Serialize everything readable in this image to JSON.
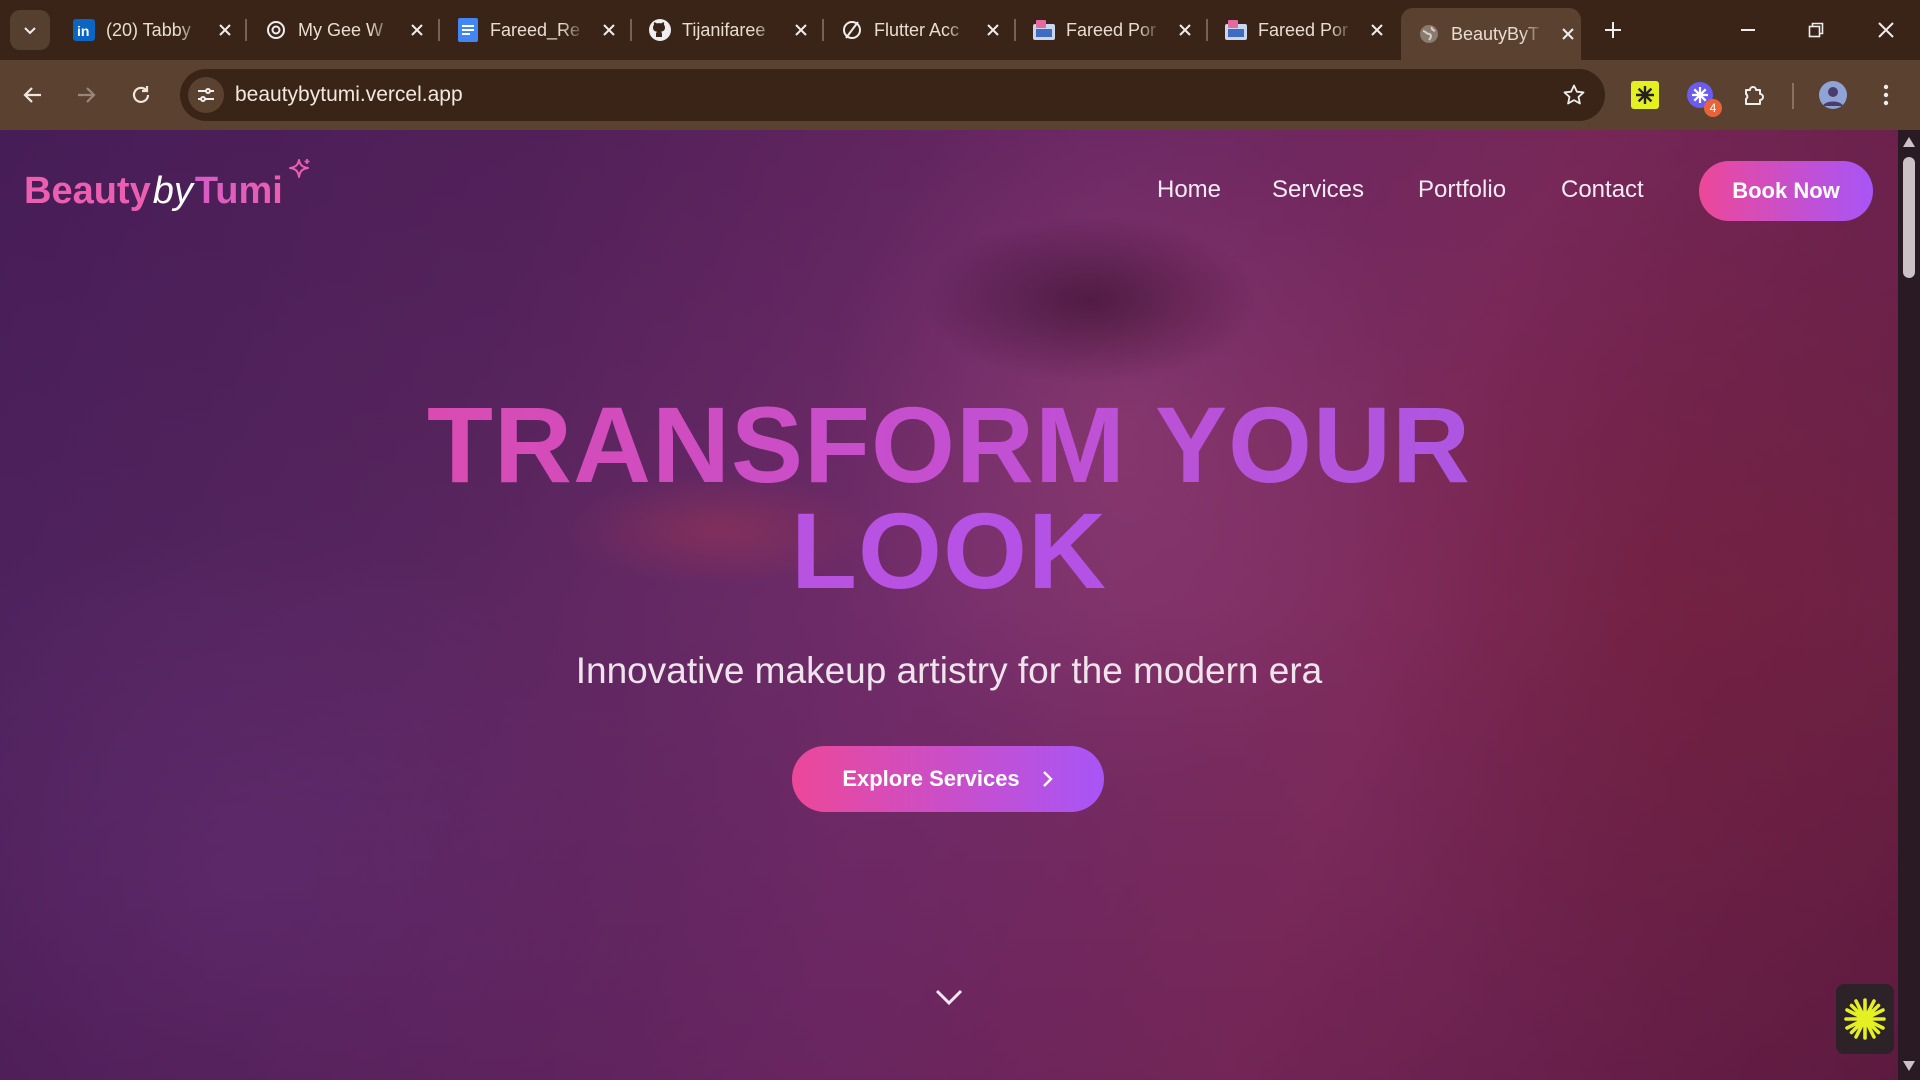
{
  "browser": {
    "tabs": [
      {
        "title": "(20) Tabby",
        "icon": "linkedin-icon"
      },
      {
        "title": "My Gee W",
        "icon": "openai-icon"
      },
      {
        "title": "Fareed_Re",
        "icon": "docs-icon"
      },
      {
        "title": "Tijanifaree",
        "icon": "github-icon"
      },
      {
        "title": "Flutter Acc",
        "icon": "slash-circle-icon"
      },
      {
        "title": "Fareed Por",
        "icon": "portfolio-icon"
      },
      {
        "title": "Fareed Por",
        "icon": "portfolio-icon"
      },
      {
        "title": "BeautyByT",
        "icon": "globe-icon",
        "active": true
      }
    ],
    "url": "beautybytumi.vercel.app",
    "extension_badge": "4"
  },
  "site": {
    "logo": {
      "beauty": "Beauty",
      "by": "by",
      "tumi": "Tumi"
    },
    "nav": [
      "Home",
      "Services",
      "Portfolio",
      "Contact"
    ],
    "book_button": "Book Now",
    "headline_line1": "TRANSFORM YOUR",
    "headline_line2": "LOOK",
    "subtitle": "Innovative makeup artistry for the modern era",
    "cta": "Explore Services"
  },
  "colors": {
    "accent_pink": "#ec4899",
    "accent_purple": "#a855f7",
    "chrome_dark": "#3a2417",
    "chrome_toolbar": "#5b4130"
  }
}
